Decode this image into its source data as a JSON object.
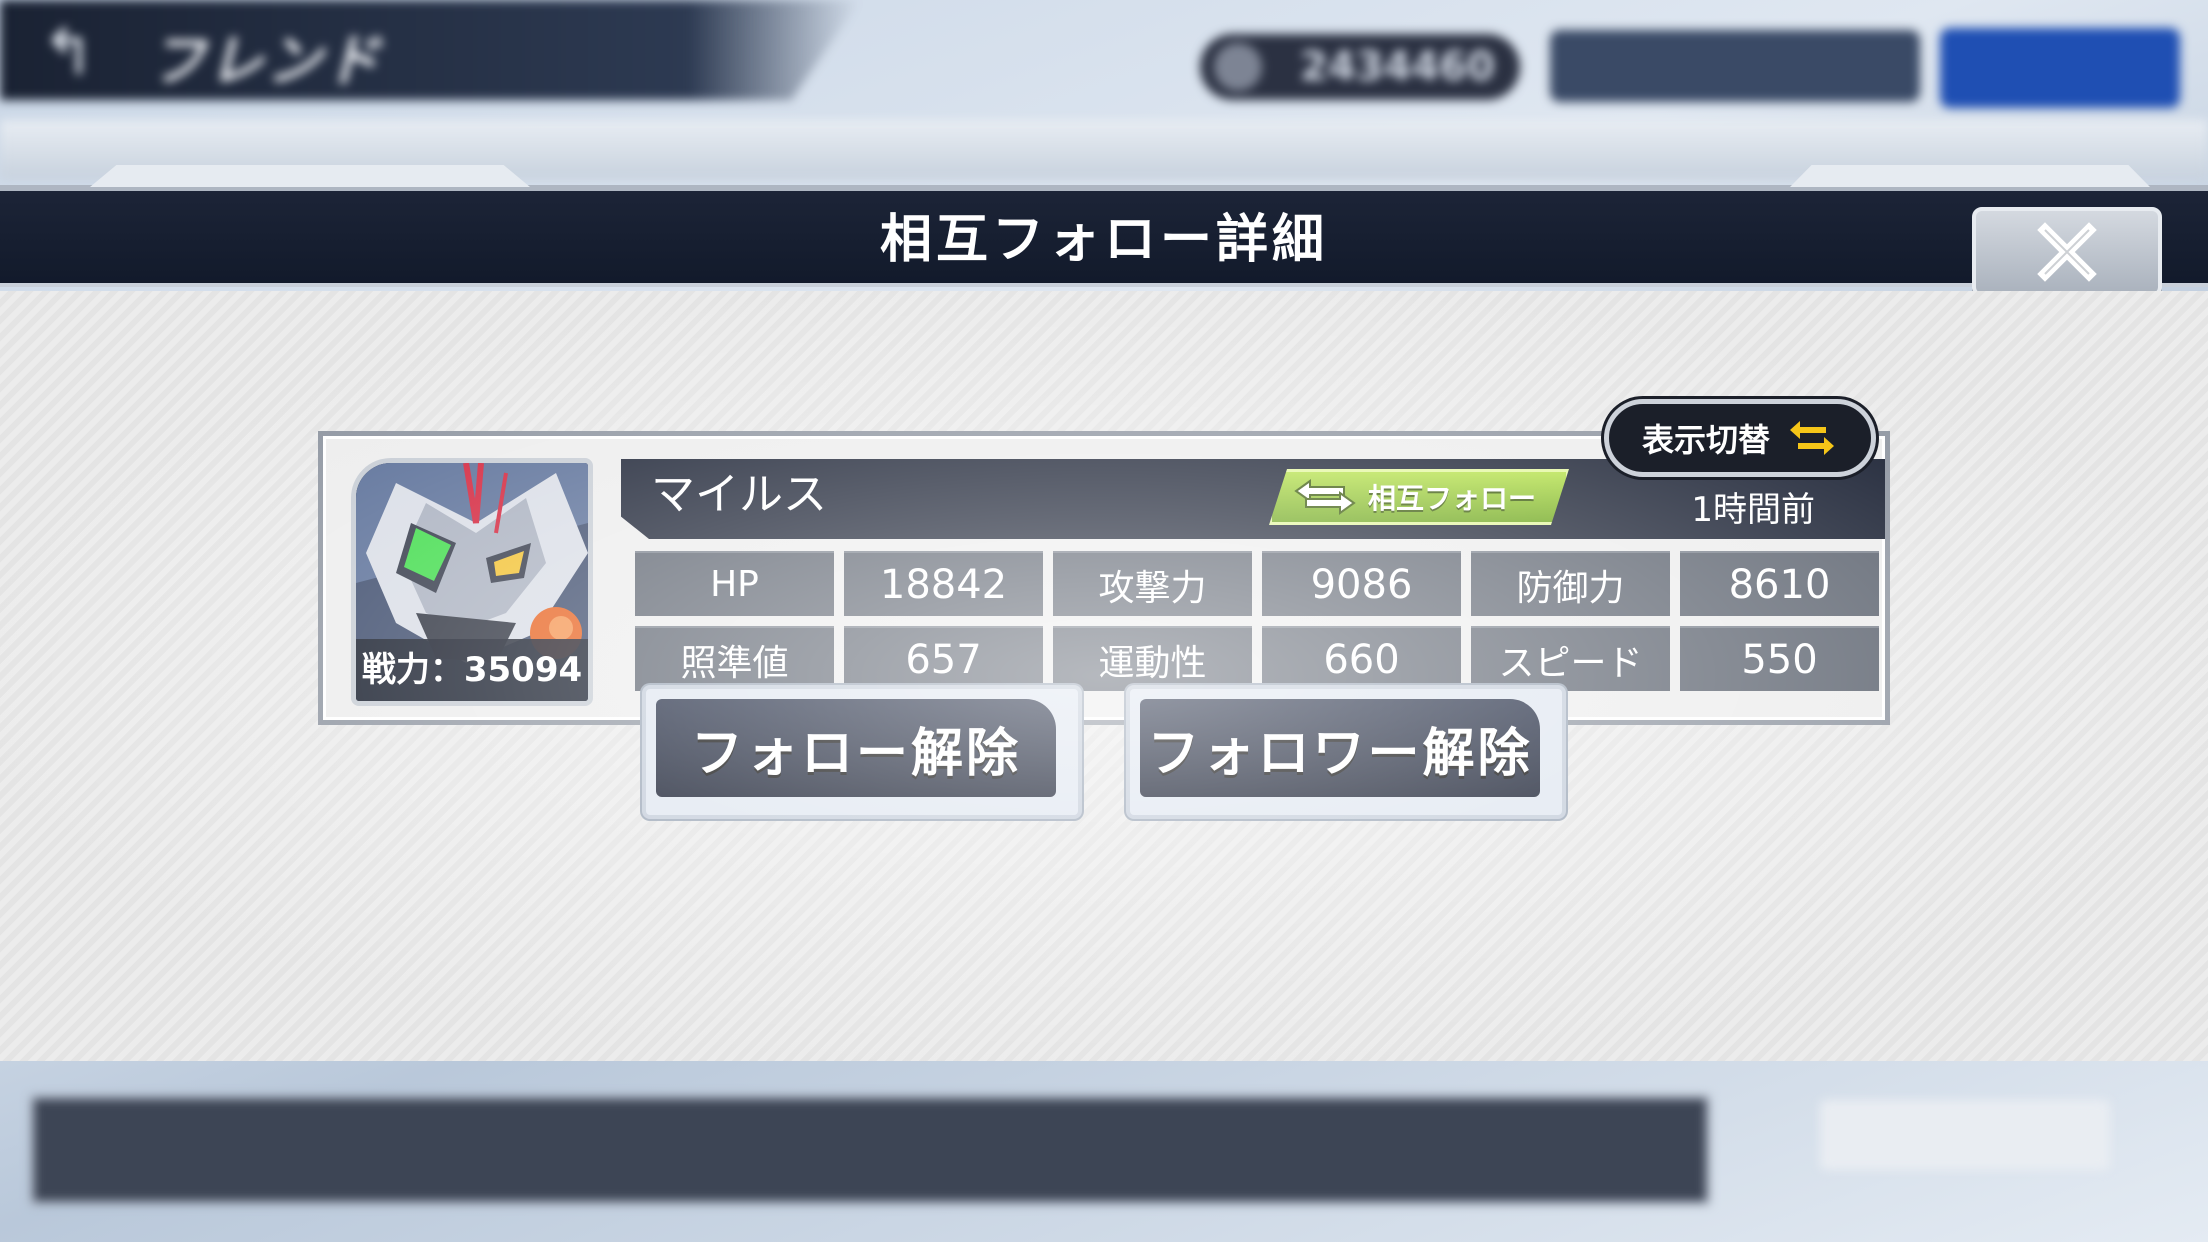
{
  "background": {
    "header_title": "フレンド",
    "currency_value": "2434460"
  },
  "modal": {
    "title": "相互フォロー詳細",
    "toggle_label": "表示切替"
  },
  "friend": {
    "name": "マイルス",
    "power_label": "戦力：35094",
    "relation_badge": "相互フォロー",
    "last_login": "1時間前",
    "stats": [
      {
        "label": "HP",
        "value": "18842"
      },
      {
        "label": "攻撃力",
        "value": "9086"
      },
      {
        "label": "防御力",
        "value": "8610"
      },
      {
        "label": "照準値",
        "value": "657"
      },
      {
        "label": "運動性",
        "value": "660"
      },
      {
        "label": "スピード",
        "value": "550"
      }
    ]
  },
  "actions": {
    "unfollow_label": "フォロー解除",
    "remove_follower_label": "フォロワー解除"
  },
  "colors": {
    "titlebar": "#121a2b",
    "badge_green": "#8cc63f",
    "toggle_arrow": "#f5c518",
    "stat_cell": "#5d6470"
  },
  "icons": {
    "back": "back-arrow-icon",
    "close": "close-x-icon",
    "toggle": "swap-arrows-icon",
    "mutual": "mutual-follow-arrows-icon"
  }
}
